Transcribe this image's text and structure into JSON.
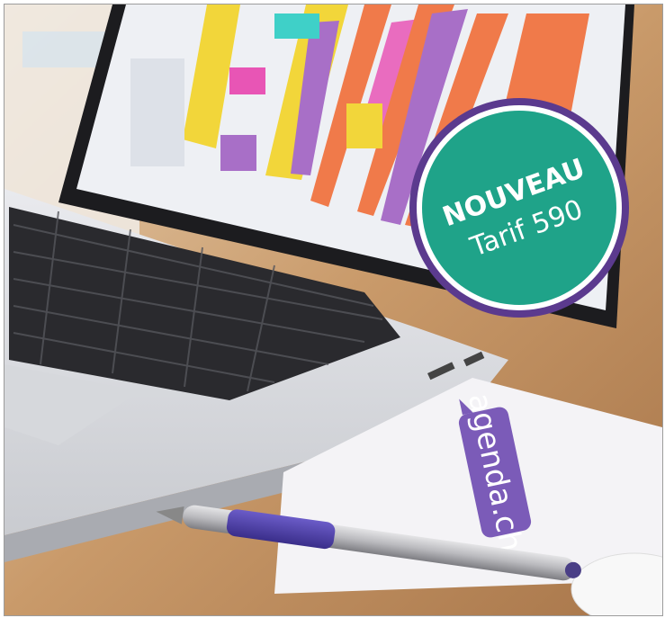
{
  "badge": {
    "line1": "NOUVEAU",
    "line2": "Tarif 590",
    "fill_color": "#1fa389",
    "ring_color": "#5b3a8e"
  },
  "brand": {
    "text": "agenda.ch",
    "color": "#7b5bb8"
  },
  "scene": {
    "calendar_column_colors": [
      "#f2d63a",
      "#f07a4a",
      "#a86fc7",
      "#e855b5",
      "#f2d63a",
      "#f07a4a"
    ]
  }
}
